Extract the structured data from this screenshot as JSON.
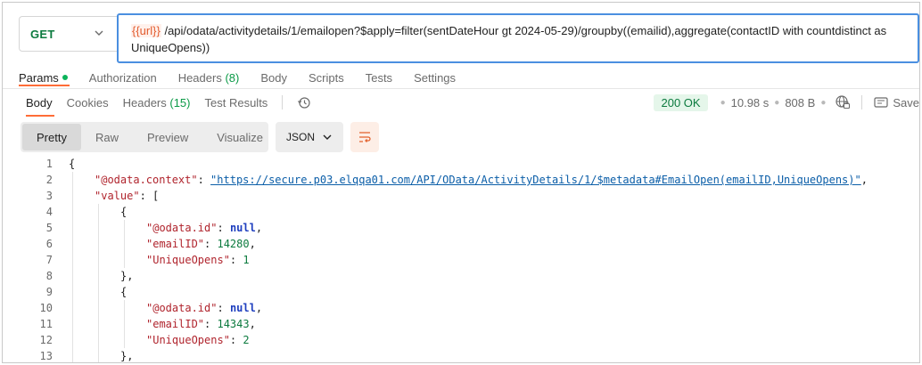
{
  "request": {
    "method": "GET",
    "url_variable": "{{url}}",
    "url_path": "/api/odata/activitydetails/1/emailopen?$apply=filter(sentDateHour gt 2024-05-29)/groupby((emailid),aggregate(contactID with countdistinct as UniqueOpens))"
  },
  "request_tabs": [
    {
      "label": "Params",
      "active": true,
      "dot": true
    },
    {
      "label": "Authorization"
    },
    {
      "label": "Headers",
      "count": "(8)"
    },
    {
      "label": "Body"
    },
    {
      "label": "Scripts"
    },
    {
      "label": "Tests"
    },
    {
      "label": "Settings"
    }
  ],
  "response_tabs": [
    {
      "label": "Body",
      "active": true
    },
    {
      "label": "Cookies"
    },
    {
      "label": "Headers",
      "count": "(15)"
    },
    {
      "label": "Test Results"
    }
  ],
  "status": {
    "code": "200 OK",
    "time": "10.98 s",
    "size": "808 B",
    "save_label": "Save"
  },
  "format_buttons": [
    {
      "label": "Pretty",
      "active": true
    },
    {
      "label": "Raw"
    },
    {
      "label": "Preview"
    },
    {
      "label": "Visualize"
    }
  ],
  "language": "JSON",
  "code_lines": [
    {
      "n": "1",
      "i": 0,
      "p": [
        [
          "p",
          "{"
        ]
      ]
    },
    {
      "n": "2",
      "i": 1,
      "p": [
        [
          "k",
          "\"@odata.context\""
        ],
        [
          "p",
          ": "
        ],
        [
          "s",
          "\"https://secure.p03.elqqa01.com/API/OData/ActivityDetails/1/$metadata#EmailOpen(emailID,UniqueOpens)\""
        ],
        [
          "p",
          ","
        ]
      ]
    },
    {
      "n": "3",
      "i": 1,
      "p": [
        [
          "k",
          "\"value\""
        ],
        [
          "p",
          ": ["
        ]
      ]
    },
    {
      "n": "4",
      "i": 2,
      "p": [
        [
          "p",
          "{"
        ]
      ]
    },
    {
      "n": "5",
      "i": 3,
      "p": [
        [
          "k",
          "\"@odata.id\""
        ],
        [
          "p",
          ": "
        ],
        [
          "kw",
          "null"
        ],
        [
          "p",
          ","
        ]
      ]
    },
    {
      "n": "6",
      "i": 3,
      "p": [
        [
          "k",
          "\"emailID\""
        ],
        [
          "p",
          ": "
        ],
        [
          "n",
          "14280"
        ],
        [
          "p",
          ","
        ]
      ]
    },
    {
      "n": "7",
      "i": 3,
      "p": [
        [
          "k",
          "\"UniqueOpens\""
        ],
        [
          "p",
          ": "
        ],
        [
          "n",
          "1"
        ]
      ]
    },
    {
      "n": "8",
      "i": 2,
      "p": [
        [
          "p",
          "},"
        ]
      ]
    },
    {
      "n": "9",
      "i": 2,
      "p": [
        [
          "p",
          "{"
        ]
      ]
    },
    {
      "n": "10",
      "i": 3,
      "p": [
        [
          "k",
          "\"@odata.id\""
        ],
        [
          "p",
          ": "
        ],
        [
          "kw",
          "null"
        ],
        [
          "p",
          ","
        ]
      ]
    },
    {
      "n": "11",
      "i": 3,
      "p": [
        [
          "k",
          "\"emailID\""
        ],
        [
          "p",
          ": "
        ],
        [
          "n",
          "14343"
        ],
        [
          "p",
          ","
        ]
      ]
    },
    {
      "n": "12",
      "i": 3,
      "p": [
        [
          "k",
          "\"UniqueOpens\""
        ],
        [
          "p",
          ": "
        ],
        [
          "n",
          "2"
        ]
      ]
    },
    {
      "n": "13",
      "i": 2,
      "p": [
        [
          "p",
          "},"
        ]
      ]
    }
  ]
}
